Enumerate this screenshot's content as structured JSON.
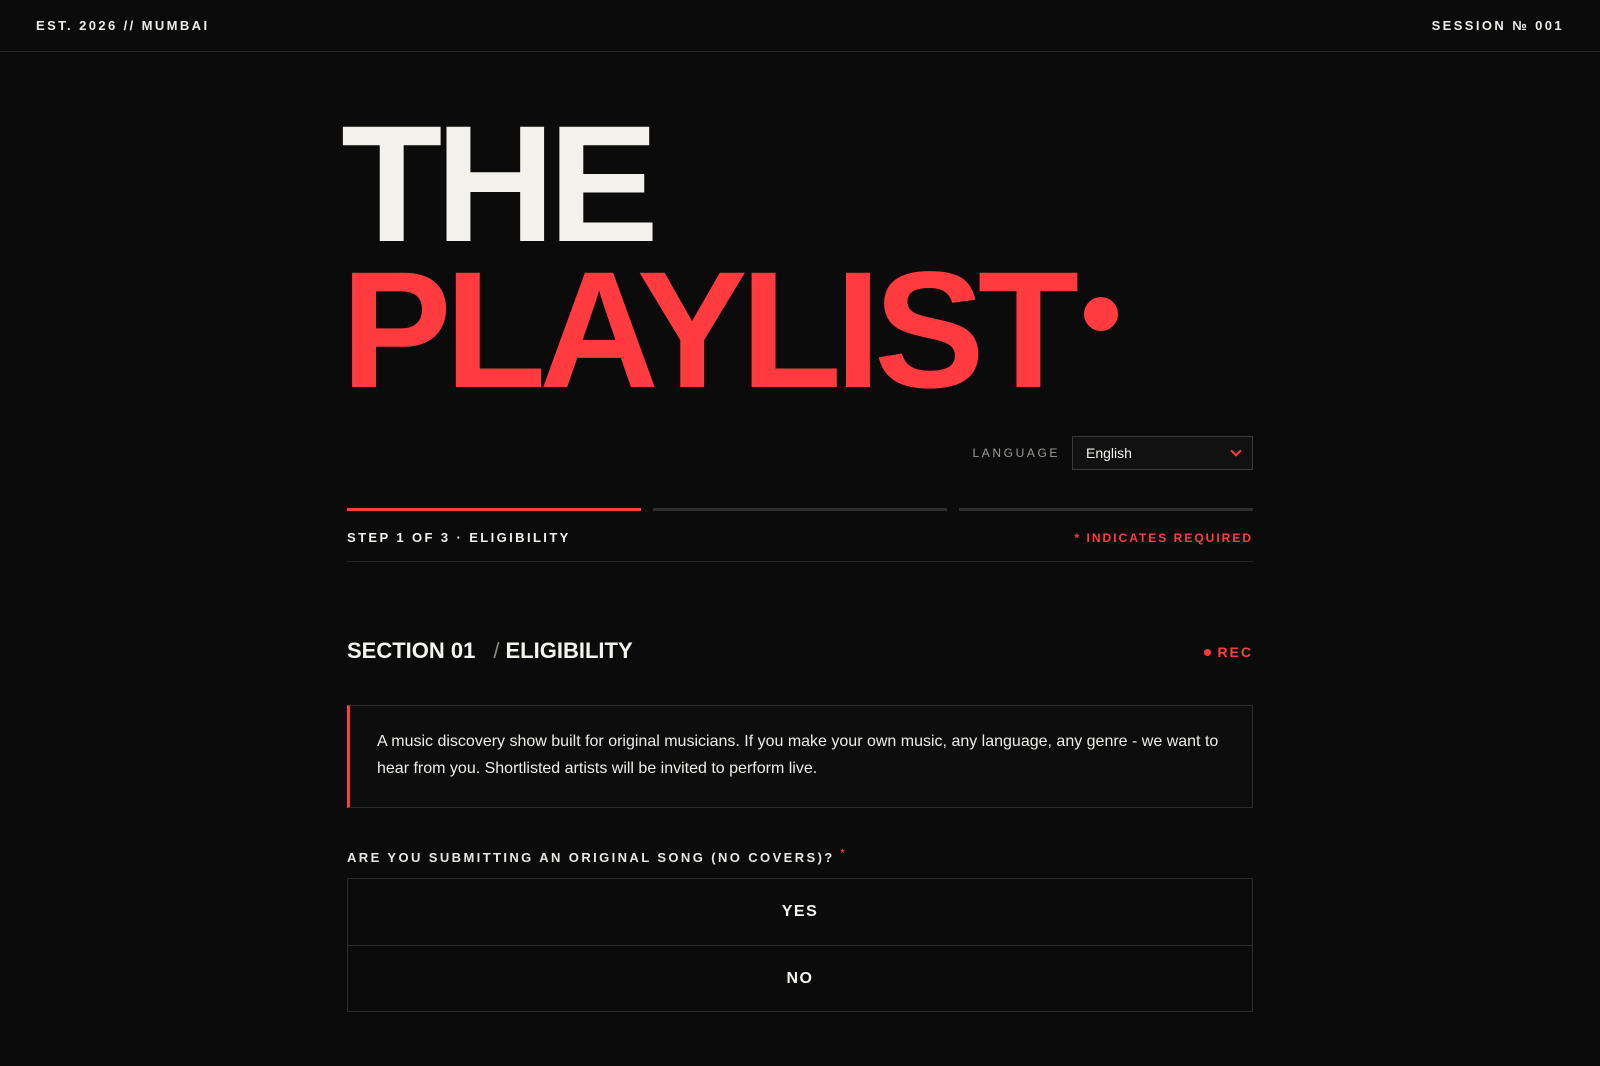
{
  "topbar": {
    "left": "EST. 2026 // MUMBAI",
    "right": "SESSION № 001"
  },
  "hero": {
    "line1": "THE",
    "line2": "PLAYLIST"
  },
  "language": {
    "label": "LANGUAGE",
    "selected": "English"
  },
  "progress": {
    "current_step": 1,
    "total_steps": 3,
    "step_label": "STEP 1 OF 3 · ELIGIBILITY",
    "required_note": "* INDICATES REQUIRED"
  },
  "section": {
    "number": "SECTION 01",
    "name": "ELIGIBILITY",
    "rec_label": "REC"
  },
  "intro_text": "A music discovery show built for original musicians. If you make your own music, any language, any genre - we want to hear from you. Shortlisted artists will be invited to perform live.",
  "question": {
    "label": "ARE YOU SUBMITTING AN ORIGINAL SONG (NO COVERS)?",
    "required_mark": "*",
    "options": [
      "YES",
      "NO"
    ]
  },
  "colors": {
    "background": "#0b0b0b",
    "accent": "#ff3b3f",
    "text": "#f2f2ee"
  }
}
